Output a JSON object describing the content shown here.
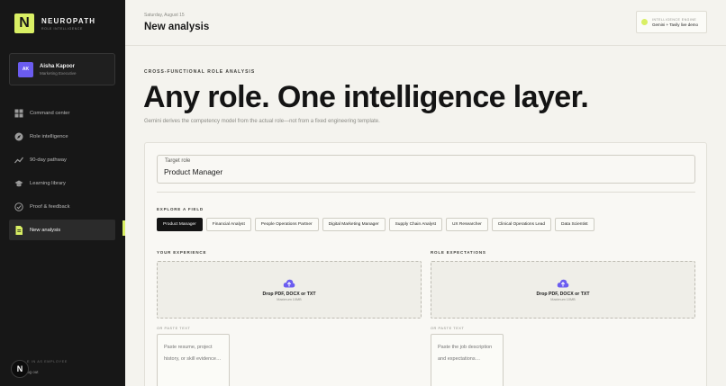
{
  "brand": {
    "mark": "N",
    "name": "NEUROPATH",
    "tagline": "ROLE INTELLIGENCE",
    "accent": "#d9ef64"
  },
  "profile": {
    "initials": "AK",
    "name": "Aisha Kapoor",
    "role": "Marketing Executive"
  },
  "nav": {
    "items": [
      {
        "label": "Command center",
        "icon": "grid-icon"
      },
      {
        "label": "Role intelligence",
        "icon": "compass-icon"
      },
      {
        "label": "90-day pathway",
        "icon": "trend-icon"
      },
      {
        "label": "Learning library",
        "icon": "graduation-cap-icon"
      },
      {
        "label": "Proof & feedback",
        "icon": "check-circle-icon"
      },
      {
        "label": "New analysis",
        "icon": "document-icon",
        "active": true
      }
    ]
  },
  "sidebar_footer": {
    "avatar": "N",
    "role_label": "E IN AS EMPLOYEE",
    "logout": "og out"
  },
  "header": {
    "date": "Saturday, August 15",
    "title": "New analysis",
    "engine_label": "INTELLIGENCE ENGINE",
    "engine_value": "Gemini + Tavily live demo"
  },
  "main": {
    "eyebrow": "CROSS-FUNCTIONAL ROLE ANALYSIS",
    "hero": "Any role. One intelligence layer.",
    "subtitle": "Gemini derives the competency model from the actual role—not from a fixed engineering template.",
    "target_role": {
      "label": "Target role",
      "value": "Product Manager"
    },
    "explore_label": "EXPLORE A FIELD",
    "fields": [
      {
        "label": "Product Manager",
        "active": true
      },
      {
        "label": "Financial Analyst"
      },
      {
        "label": "People Operations Partner"
      },
      {
        "label": "Digital Marketing Manager"
      },
      {
        "label": "Supply Chain Analyst"
      },
      {
        "label": "UX Researcher"
      },
      {
        "label": "Clinical Operations Lead"
      },
      {
        "label": "Data Scientist"
      }
    ],
    "experience": {
      "label": "YOUR EXPERIENCE",
      "drop_title": "Drop PDF, DOCX or TXT",
      "drop_sub": "Maximum 10MB",
      "paste_label": "OR PASTE TEXT",
      "paste_placeholder": "Paste resume, project history, or skill evidence…"
    },
    "expectations": {
      "label": "ROLE EXPECTATIONS",
      "drop_title": "Drop PDF, DOCX or TXT",
      "drop_sub": "Maximum 10MB",
      "paste_label": "OR PASTE TEXT",
      "paste_placeholder": "Paste the job description and expectations…"
    }
  }
}
